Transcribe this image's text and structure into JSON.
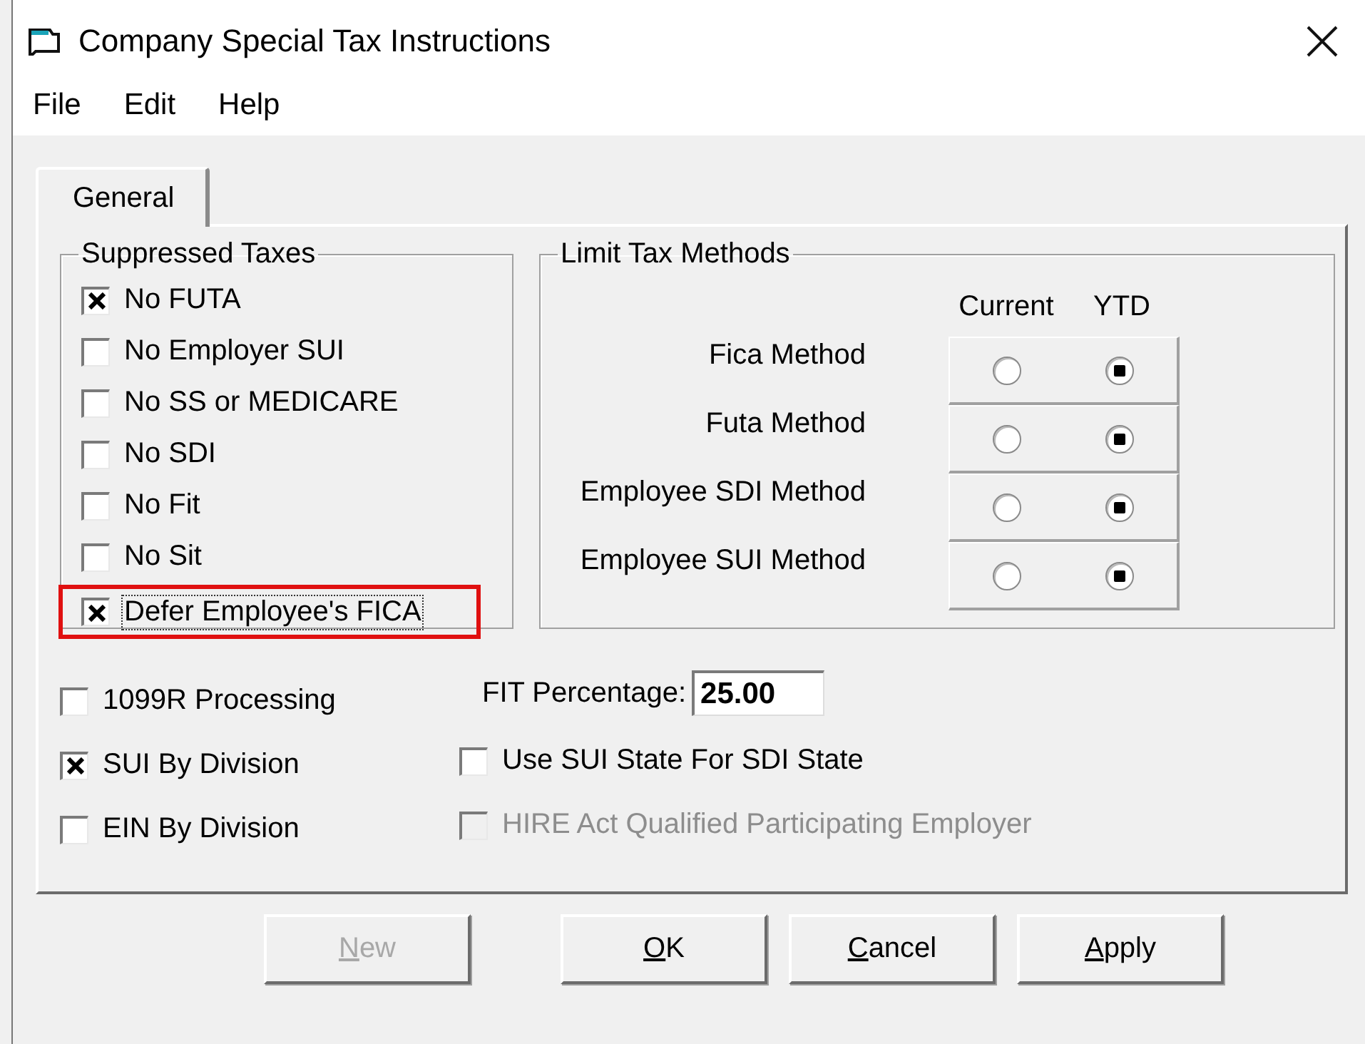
{
  "window": {
    "title": "Company Special Tax Instructions"
  },
  "menu": [
    {
      "label": "File"
    },
    {
      "label": "Edit"
    },
    {
      "label": "Help"
    }
  ],
  "tabs": [
    {
      "label": "General",
      "selected": true
    }
  ],
  "suppressed_taxes": {
    "title": "Suppressed Taxes",
    "items": [
      {
        "label": "No FUTA",
        "checked": true,
        "highlighted": false,
        "focused": false
      },
      {
        "label": "No Employer SUI",
        "checked": false,
        "highlighted": false,
        "focused": false
      },
      {
        "label": "No SS or MEDICARE",
        "checked": false,
        "highlighted": false,
        "focused": false
      },
      {
        "label": "No SDI",
        "checked": false,
        "highlighted": false,
        "focused": false
      },
      {
        "label": "No Fit",
        "checked": false,
        "highlighted": false,
        "focused": false
      },
      {
        "label": "No Sit",
        "checked": false,
        "highlighted": false,
        "focused": false
      },
      {
        "label": "Defer Employee's FICA",
        "checked": true,
        "highlighted": true,
        "focused": true
      }
    ]
  },
  "limit_tax_methods": {
    "title": "Limit Tax Methods",
    "columns": [
      "Current",
      "YTD"
    ],
    "rows": [
      {
        "label": "Fica Method",
        "options": [
          {
            "selected": false
          },
          {
            "selected": true
          }
        ]
      },
      {
        "label": "Futa Method",
        "options": [
          {
            "selected": false
          },
          {
            "selected": true
          }
        ]
      },
      {
        "label": "Employee SDI Method",
        "options": [
          {
            "selected": false
          },
          {
            "selected": true
          }
        ]
      },
      {
        "label": "Employee SUI Method",
        "options": [
          {
            "selected": false
          },
          {
            "selected": true
          }
        ]
      }
    ]
  },
  "options_left": [
    {
      "label": "1099R Processing",
      "checked": false
    },
    {
      "label": "SUI By Division",
      "checked": true
    },
    {
      "label": "EIN By Division",
      "checked": false
    }
  ],
  "fit_percentage": {
    "label": "FIT Percentage:",
    "value": "25.00"
  },
  "options_right": [
    {
      "label": "Use SUI State For SDI State",
      "checked": false,
      "disabled": false
    },
    {
      "label": "HIRE Act Qualified Participating Employer",
      "checked": false,
      "disabled": true
    }
  ],
  "buttons": [
    {
      "label": "New",
      "first_letter_underlined": true,
      "disabled": true
    },
    {
      "label": "OK",
      "first_letter_underlined": true,
      "disabled": false
    },
    {
      "label": "Cancel",
      "first_letter_underlined": true,
      "disabled": false
    },
    {
      "label": "Apply",
      "first_letter_underlined": true,
      "disabled": false
    }
  ]
}
